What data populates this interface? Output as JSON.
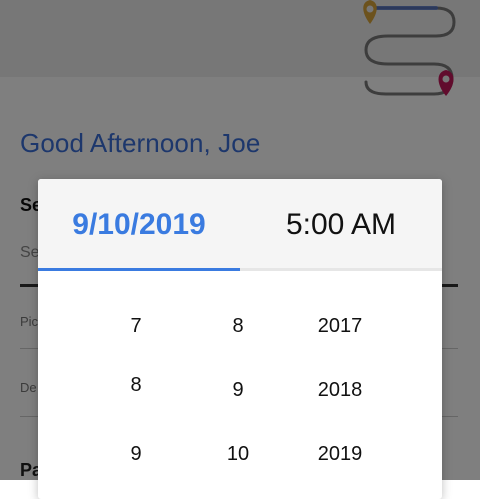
{
  "app": {
    "greeting": "Good Afternoon, Joe",
    "section_label": "Se",
    "search_placeholder": "Se",
    "pickup_label": "Pic",
    "destination_label": "De",
    "bottom_section_label": "Pa"
  },
  "picker": {
    "date_tab": "9/10/2019",
    "time_tab": "5:00 AM",
    "active_tab": "date",
    "months": [
      "7",
      "8",
      "9"
    ],
    "days": [
      "8",
      "9",
      "10"
    ],
    "years": [
      "2017",
      "2018",
      "2019"
    ]
  },
  "colors": {
    "accent": "#3a7be0",
    "greeting": "#3b6fd8",
    "pin_origin": "#d8a43a",
    "pin_destination": "#c2185b",
    "route": "#7a7a7a"
  },
  "icons": {
    "route": "route-illustration",
    "origin": "map-pin-icon",
    "destination": "map-pin-icon"
  }
}
